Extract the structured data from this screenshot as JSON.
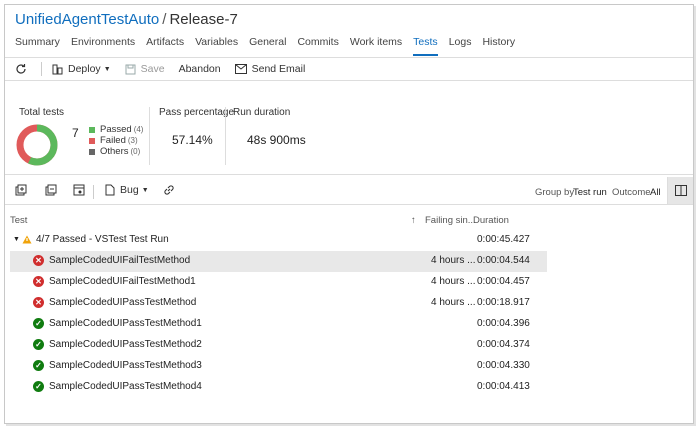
{
  "header": {
    "project": "UnifiedAgentTestAuto",
    "separator": "/",
    "release": "Release-7"
  },
  "tabs": [
    {
      "label": "Summary"
    },
    {
      "label": "Environments"
    },
    {
      "label": "Artifacts"
    },
    {
      "label": "Variables"
    },
    {
      "label": "General"
    },
    {
      "label": "Commits"
    },
    {
      "label": "Work items"
    },
    {
      "label": "Tests"
    },
    {
      "label": "Logs"
    },
    {
      "label": "History"
    }
  ],
  "active_tab": "Tests",
  "toolbar": {
    "deploy": "Deploy",
    "save": "Save",
    "abandon": "Abandon",
    "send_email": "Send Email"
  },
  "summary": {
    "total_tests_label": "Total tests",
    "total_tests": "7",
    "passed_label": "Passed",
    "passed_count": "(4)",
    "failed_label": "Failed",
    "failed_count": "(3)",
    "others_label": "Others",
    "others_count": "(0)",
    "pass_pct_label": "Pass percentage",
    "pass_pct": "57.14%",
    "duration_label": "Run duration",
    "duration": "48s 900ms",
    "colors": {
      "passed": "#5cb85c",
      "failed": "#e05a5a",
      "others": "#666666"
    },
    "counts": {
      "passed": 4,
      "failed": 3,
      "others": 0
    }
  },
  "toolbar2": {
    "bug": "Bug",
    "group_by_label": "Group by",
    "group_by_value": "Test run",
    "outcome_label": "Outcome",
    "outcome_value": "All"
  },
  "grid": {
    "col_test": "Test",
    "col_failing": "Failing sin...",
    "col_duration": "Duration",
    "group": {
      "label": "4/7 Passed - VSTest Test Run",
      "duration": "0:00:45.427"
    },
    "rows": [
      {
        "name": "SampleCodedUIFailTestMethod",
        "status": "fail",
        "failing": "4 hours ...",
        "duration": "0:00:04.544"
      },
      {
        "name": "SampleCodedUIFailTestMethod1",
        "status": "fail",
        "failing": "4 hours ...",
        "duration": "0:00:04.457"
      },
      {
        "name": "SampleCodedUIPassTestMethod",
        "status": "fail",
        "failing": "4 hours ...",
        "duration": "0:00:18.917"
      },
      {
        "name": "SampleCodedUIPassTestMethod1",
        "status": "pass",
        "failing": "",
        "duration": "0:00:04.396"
      },
      {
        "name": "SampleCodedUIPassTestMethod2",
        "status": "pass",
        "failing": "",
        "duration": "0:00:04.374"
      },
      {
        "name": "SampleCodedUIPassTestMethod3",
        "status": "pass",
        "failing": "",
        "duration": "0:00:04.330"
      },
      {
        "name": "SampleCodedUIPassTestMethod4",
        "status": "pass",
        "failing": "",
        "duration": "0:00:04.413"
      }
    ]
  }
}
